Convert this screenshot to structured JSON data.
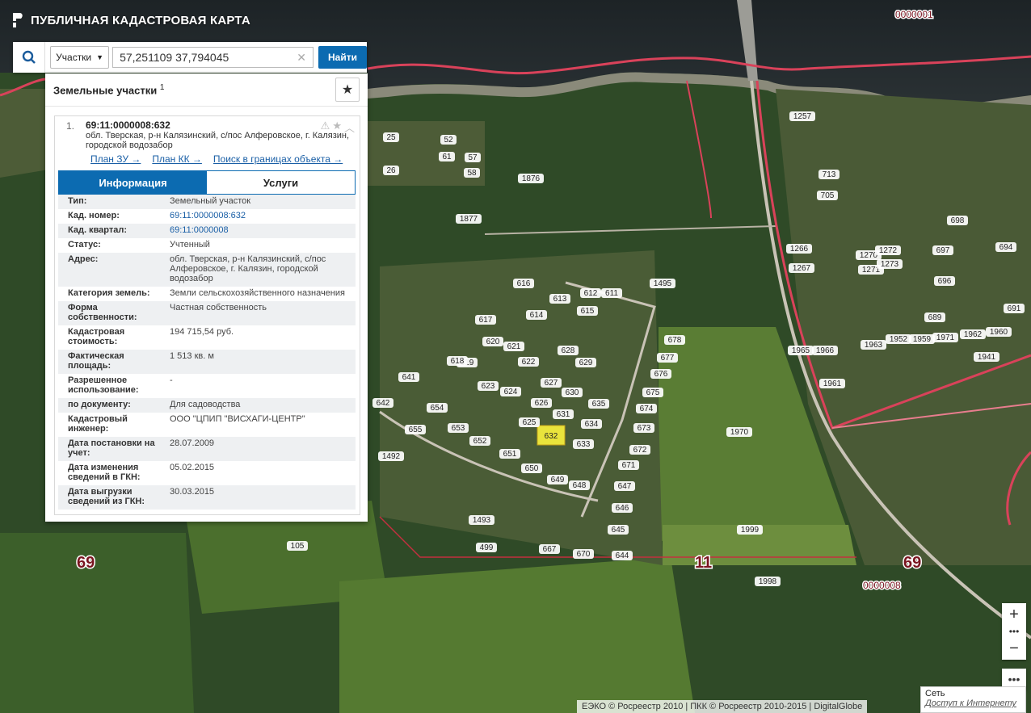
{
  "app": {
    "title": "ПУБЛИЧНАЯ КАДАСТРОВАЯ КАРТА"
  },
  "search": {
    "category": "Участки",
    "query": "57,251109 37,794045",
    "button": "Найти"
  },
  "panel": {
    "title": "Земельные участки",
    "count": "1",
    "result": {
      "index": "1.",
      "cad_number": "69:11:0000008:632",
      "address": "обл. Тверская, р-н Калязинский, с/пос Алферовское, г. Калязин, городской водозабор",
      "links": [
        "План ЗУ →",
        "План КК →",
        "Поиск в границах объекта →"
      ],
      "tabs": [
        "Информация",
        "Услуги"
      ],
      "rows": [
        {
          "k": "Тип:",
          "v": "Земельный участок"
        },
        {
          "k": "Кад. номер:",
          "v": "69:11:0000008:632"
        },
        {
          "k": "Кад. квартал:",
          "v": "69:11:0000008"
        },
        {
          "k": "Статус:",
          "v": "Учтенный"
        },
        {
          "k": "Адрес:",
          "v": "обл. Тверская, р-н Калязинский, с/пос Алферовское, г. Калязин, городской водозабор"
        },
        {
          "k": "Категория земель:",
          "v": "Земли сельскохозяйственного назначения"
        },
        {
          "k": "Форма собственности:",
          "v": "Частная собственность"
        },
        {
          "k": "Кадастровая стоимость:",
          "v": "194 715,54 руб."
        },
        {
          "k": "Фактическая площадь:",
          "v": "1 513 кв. м"
        },
        {
          "k": "Разрешенное использование:",
          "v": "-"
        },
        {
          "k": "по документу:",
          "v": "Для садоводства"
        },
        {
          "k": "Кадастровый инженер:",
          "v": "ООО \"ЦПИП \"ВИСХАГИ-ЦЕНТР\""
        },
        {
          "k": "Дата постановки на учет:",
          "v": "28.07.2009"
        },
        {
          "k": "Дата изменения сведений в ГКН:",
          "v": "05.02.2015"
        },
        {
          "k": "Дата выгрузки сведений из ГКН:",
          "v": "30.03.2015"
        }
      ]
    }
  },
  "map": {
    "region_codes": [
      "69",
      "11",
      "69"
    ],
    "quarter_codes": [
      "0000001",
      "0000008"
    ],
    "selected_parcel": "632",
    "parcel_labels": [
      "1257",
      "1876",
      "1877",
      "1495",
      "1970",
      "1999",
      "1998",
      "1493",
      "105",
      "499",
      "667",
      "670",
      "644",
      "645",
      "646",
      "647",
      "671",
      "672",
      "673",
      "674",
      "675",
      "676",
      "677",
      "678",
      "633",
      "634",
      "635",
      "625",
      "631",
      "629",
      "630",
      "626",
      "627",
      "628",
      "624",
      "623",
      "622",
      "621",
      "620",
      "619",
      "618",
      "617",
      "616",
      "614",
      "613",
      "612",
      "611",
      "615",
      "642",
      "641",
      "655",
      "654",
      "653",
      "652",
      "651",
      "650",
      "649",
      "648",
      "1492",
      "1965",
      "1966",
      "1963",
      "1952",
      "1959",
      "1971",
      "1962",
      "1960",
      "1961",
      "1941",
      "1270",
      "1271",
      "1272",
      "1273",
      "1266",
      "1267",
      "689",
      "691",
      "694",
      "696",
      "697",
      "698",
      "705",
      "713",
      "25",
      "26",
      "52",
      "61",
      "58",
      "57"
    ],
    "attribution": "ЕЭКО © Росреестр 2010 | ПКК © Росреестр 2010-2015 | DigitalGlobe",
    "network_label": "Сеть",
    "network_status": "Доступ к Интернету"
  }
}
